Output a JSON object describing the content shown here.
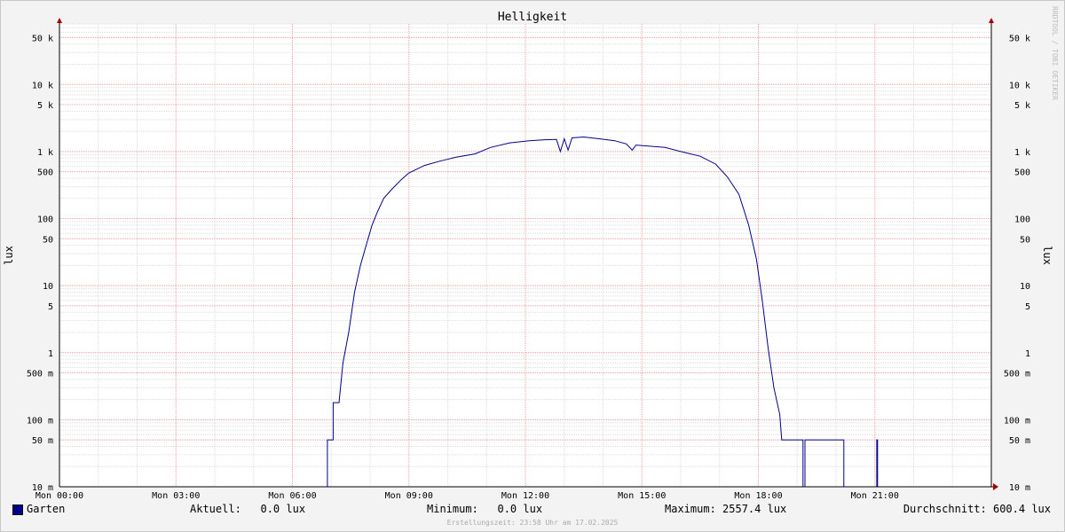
{
  "chart_data": {
    "type": "line",
    "title": "Helligkeit",
    "ylabel": "lux",
    "yscale": "log",
    "ylim": [
      0.01,
      80000
    ],
    "xlim": [
      0,
      24
    ],
    "x_tick_labels": [
      "Mon 00:00",
      "Mon 03:00",
      "Mon 06:00",
      "Mon 09:00",
      "Mon 12:00",
      "Mon 15:00",
      "Mon 18:00",
      "Mon 21:00"
    ],
    "y_ticks": [
      {
        "v": 0.01,
        "label": "10 m"
      },
      {
        "v": 0.05,
        "label": "50 m"
      },
      {
        "v": 0.1,
        "label": "100 m"
      },
      {
        "v": 0.5,
        "label": "500 m"
      },
      {
        "v": 1,
        "label": "1"
      },
      {
        "v": 5,
        "label": "5"
      },
      {
        "v": 10,
        "label": "10"
      },
      {
        "v": 50,
        "label": "50"
      },
      {
        "v": 100,
        "label": "100"
      },
      {
        "v": 500,
        "label": "500"
      },
      {
        "v": 1000,
        "label": "1 k"
      },
      {
        "v": 5000,
        "label": "5 k"
      },
      {
        "v": 10000,
        "label": "10 k"
      },
      {
        "v": 50000,
        "label": "50 k"
      }
    ],
    "grid": true,
    "series": [
      {
        "name": "Garten",
        "color": "#00008b",
        "points": [
          [
            0,
            0.01
          ],
          [
            6.9,
            0.01
          ],
          [
            6.9,
            0.05
          ],
          [
            7.05,
            0.05
          ],
          [
            7.05,
            0.18
          ],
          [
            7.2,
            0.18
          ],
          [
            7.3,
            0.7
          ],
          [
            7.45,
            2
          ],
          [
            7.6,
            8
          ],
          [
            7.75,
            20
          ],
          [
            7.9,
            40
          ],
          [
            8.05,
            80
          ],
          [
            8.2,
            130
          ],
          [
            8.35,
            200
          ],
          [
            8.55,
            270
          ],
          [
            8.8,
            380
          ],
          [
            9.0,
            480
          ],
          [
            9.4,
            620
          ],
          [
            9.8,
            720
          ],
          [
            10.2,
            820
          ],
          [
            10.5,
            880
          ],
          [
            10.7,
            920
          ],
          [
            11.1,
            1150
          ],
          [
            11.6,
            1350
          ],
          [
            12.1,
            1450
          ],
          [
            12.5,
            1500
          ],
          [
            12.8,
            1520
          ],
          [
            12.9,
            1000
          ],
          [
            13.0,
            1550
          ],
          [
            13.1,
            1050
          ],
          [
            13.2,
            1600
          ],
          [
            13.5,
            1650
          ],
          [
            13.9,
            1550
          ],
          [
            14.3,
            1450
          ],
          [
            14.6,
            1300
          ],
          [
            14.75,
            1050
          ],
          [
            14.85,
            1250
          ],
          [
            15.2,
            1200
          ],
          [
            15.6,
            1150
          ],
          [
            16.0,
            1000
          ],
          [
            16.5,
            850
          ],
          [
            16.9,
            650
          ],
          [
            17.2,
            420
          ],
          [
            17.5,
            230
          ],
          [
            17.75,
            80
          ],
          [
            17.95,
            25
          ],
          [
            18.1,
            6
          ],
          [
            18.25,
            1.2
          ],
          [
            18.4,
            0.3
          ],
          [
            18.55,
            0.12
          ],
          [
            18.6,
            0.05
          ],
          [
            19.15,
            0.05
          ],
          [
            19.15,
            0.01
          ],
          [
            19.2,
            0.01
          ],
          [
            19.2,
            0.05
          ],
          [
            20.2,
            0.05
          ],
          [
            20.2,
            0.01
          ],
          [
            21.05,
            0.01
          ],
          [
            21.05,
            0.05
          ],
          [
            21.07,
            0.05
          ],
          [
            21.07,
            0.01
          ],
          [
            24,
            0.01
          ]
        ]
      }
    ]
  },
  "legend": {
    "series_label": "Garten",
    "current": "Aktuell:   0.0 lux",
    "minimum": "Minimum:   0.0 lux",
    "maximum": "Maximum: 2557.4 lux",
    "average": "Durchschnitt: 600.4 lux"
  },
  "footer": "Erstellungszeit: 23:58 Uhr am 17.02.2025",
  "side_note": "RRDTOOL / TOBI OETIKER"
}
